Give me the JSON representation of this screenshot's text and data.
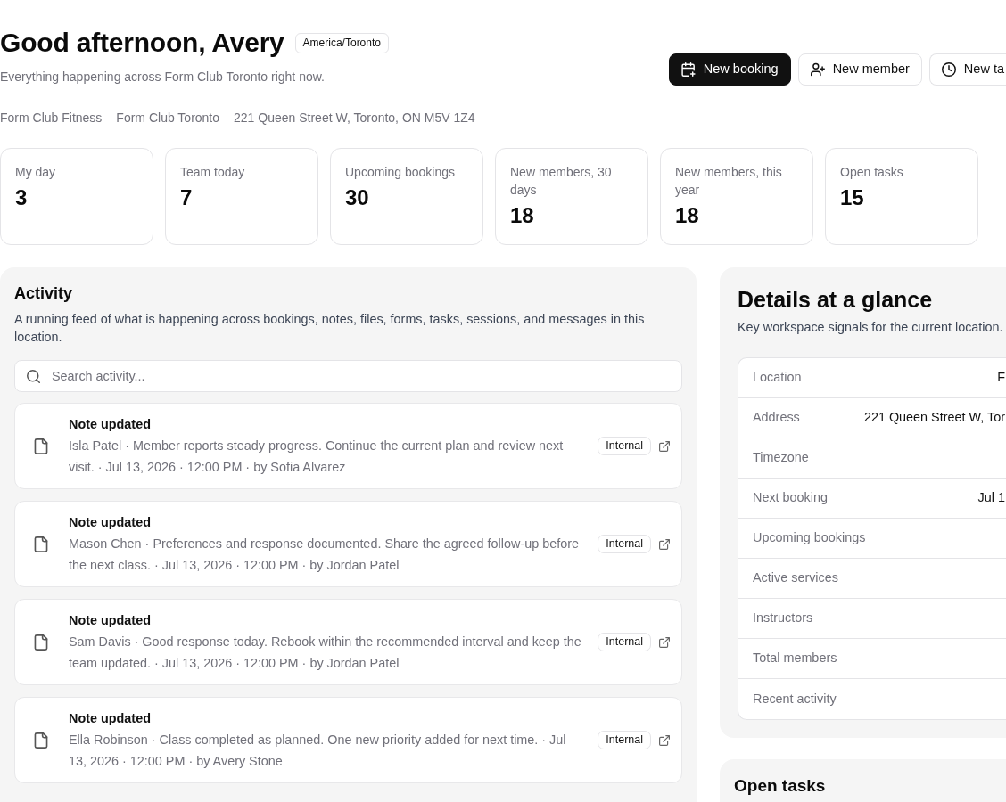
{
  "header": {
    "title": "Good afternoon, Avery",
    "timezone_badge": "America/Toronto",
    "subtitle": "Everything happening across Form Club Toronto right now.",
    "meta": [
      "Form Club Fitness",
      "Form Club Toronto",
      "221 Queen Street W, Toronto, ON M5V 1Z4"
    ],
    "actions": [
      {
        "label": "New booking",
        "kind": "primary"
      },
      {
        "label": "New member",
        "kind": "outline"
      },
      {
        "label": "New ta",
        "kind": "outline"
      }
    ]
  },
  "stats": [
    {
      "label": "My day",
      "value": "3"
    },
    {
      "label": "Team today",
      "value": "7"
    },
    {
      "label": "Upcoming bookings",
      "value": "30"
    },
    {
      "label": "New members, 30 days",
      "value": "18"
    },
    {
      "label": "New members, this year",
      "value": "18"
    },
    {
      "label": "Open tasks",
      "value": "15"
    }
  ],
  "activity": {
    "title": "Activity",
    "description": "A running feed of what is happening across bookings, notes, files, forms, tasks, sessions, and messages in this location.",
    "search": {
      "placeholder": "Search activity..."
    },
    "items": [
      {
        "title": "Note updated",
        "text": "Isla Patel · Member reports steady progress. Continue the current plan and review next visit. · Jul 13, 2026 · 12:00 PM · by Sofia Alvarez",
        "badge": "Internal"
      },
      {
        "title": "Note updated",
        "text": "Mason Chen · Preferences and response documented. Share the agreed follow-up before the next class. · Jul 13, 2026 · 12:00 PM · by Jordan Patel",
        "badge": "Internal"
      },
      {
        "title": "Note updated",
        "text": "Sam Davis · Good response today. Rebook within the recommended interval and keep the team updated. · Jul 13, 2026 · 12:00 PM · by Jordan Patel",
        "badge": "Internal"
      },
      {
        "title": "Note updated",
        "text": "Ella Robinson · Class completed as planned. One new priority added for next time. · Jul 13, 2026 · 12:00 PM · by Avery Stone",
        "badge": "Internal"
      }
    ]
  },
  "details": {
    "title": "Details at a glance",
    "description": "Key workspace signals for the current location.",
    "rows": [
      {
        "label": "Location",
        "value": "F"
      },
      {
        "label": "Address",
        "value": "221 Queen Street W, Tor"
      },
      {
        "label": "Timezone"
      },
      {
        "label": "Next booking",
        "value": "Jul 1"
      },
      {
        "label": "Upcoming bookings"
      },
      {
        "label": "Active services"
      },
      {
        "label": "Instructors"
      },
      {
        "label": "Total members"
      },
      {
        "label": "Recent activity"
      }
    ]
  },
  "open_tasks": {
    "title": "Open tasks"
  }
}
